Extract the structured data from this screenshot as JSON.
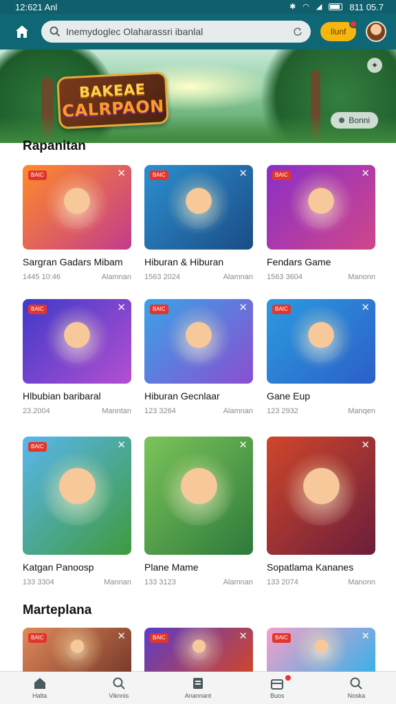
{
  "status_bar": {
    "time": "12:621 Anl",
    "right_text": "811 05.7"
  },
  "header": {
    "search_placeholder": "Inemydoglec Olaharassri ibanlal",
    "coin_label": "Ilunf"
  },
  "banner": {
    "logo_line1": "BAKEAE",
    "logo_line2": "CALRPAON",
    "button_label": "Bonni"
  },
  "sections": [
    {
      "title": "Rapanitan",
      "cards": [
        {
          "title": "Sargran Gadars Mibam",
          "date": "1445 10:46",
          "author": "Alamnan",
          "badge": "BAIC",
          "colors": [
            "#ff8a2a",
            "#c23c8c"
          ]
        },
        {
          "title": "Hiburan & Hiburan",
          "date": "1563 2024",
          "author": "Alamnan",
          "badge": "BAIC",
          "colors": [
            "#2c8fd0",
            "#1b4c85"
          ]
        },
        {
          "title": "Fendars Game",
          "date": "1563 3604",
          "author": "Manonn",
          "badge": "BAIC",
          "colors": [
            "#8a2fc8",
            "#d0468a"
          ]
        },
        {
          "title": "Hlbubian baribaral",
          "date": "23.2004",
          "author": "Manntan",
          "badge": "BAIC",
          "colors": [
            "#3e3ac9",
            "#b44fd1"
          ]
        },
        {
          "title": "Hiburan Gecnlaar",
          "date": "123 3264",
          "author": "Alamnan",
          "badge": "BAIC",
          "colors": [
            "#3aa3e8",
            "#8a4ed0"
          ]
        },
        {
          "title": "Gane Eup",
          "date": "123 2932",
          "author": "Manqen",
          "badge": "BAIC",
          "colors": [
            "#2c9be0",
            "#2c5fc8"
          ]
        }
      ]
    }
  ],
  "featured": [
    {
      "title": "Katgan Panoosp",
      "date": "133 3304",
      "author": "Mannan",
      "badge": "BAIC",
      "colors": [
        "#59b6ee",
        "#3f9a3e"
      ]
    },
    {
      "title": "Plane Mame",
      "date": "133 3123",
      "author": "Alamnan",
      "badge": "",
      "colors": [
        "#7cc45a",
        "#2d7a3b"
      ]
    },
    {
      "title": "Sopatlama Kananes",
      "date": "133 2074",
      "author": "Manonn",
      "badge": "",
      "colors": [
        "#d0462a",
        "#6a1e3c"
      ]
    }
  ],
  "section2_title": "Marteplana",
  "section2_cards": [
    {
      "badge": "BAIC",
      "colors": [
        "#e08a5a",
        "#7a3a2a"
      ]
    },
    {
      "badge": "BAIC",
      "colors": [
        "#5a3cc8",
        "#d0462a"
      ]
    },
    {
      "badge": "BAIC",
      "colors": [
        "#f5a0c8",
        "#3ab0e8"
      ]
    }
  ],
  "bottom_nav": [
    {
      "label": "Halta",
      "icon": "home-icon"
    },
    {
      "label": "Viknnis",
      "icon": "search-icon"
    },
    {
      "label": "Anannant",
      "icon": "wallet-icon"
    },
    {
      "label": "Buos",
      "icon": "gift-icon"
    },
    {
      "label": "Noska",
      "icon": "search-icon"
    }
  ]
}
